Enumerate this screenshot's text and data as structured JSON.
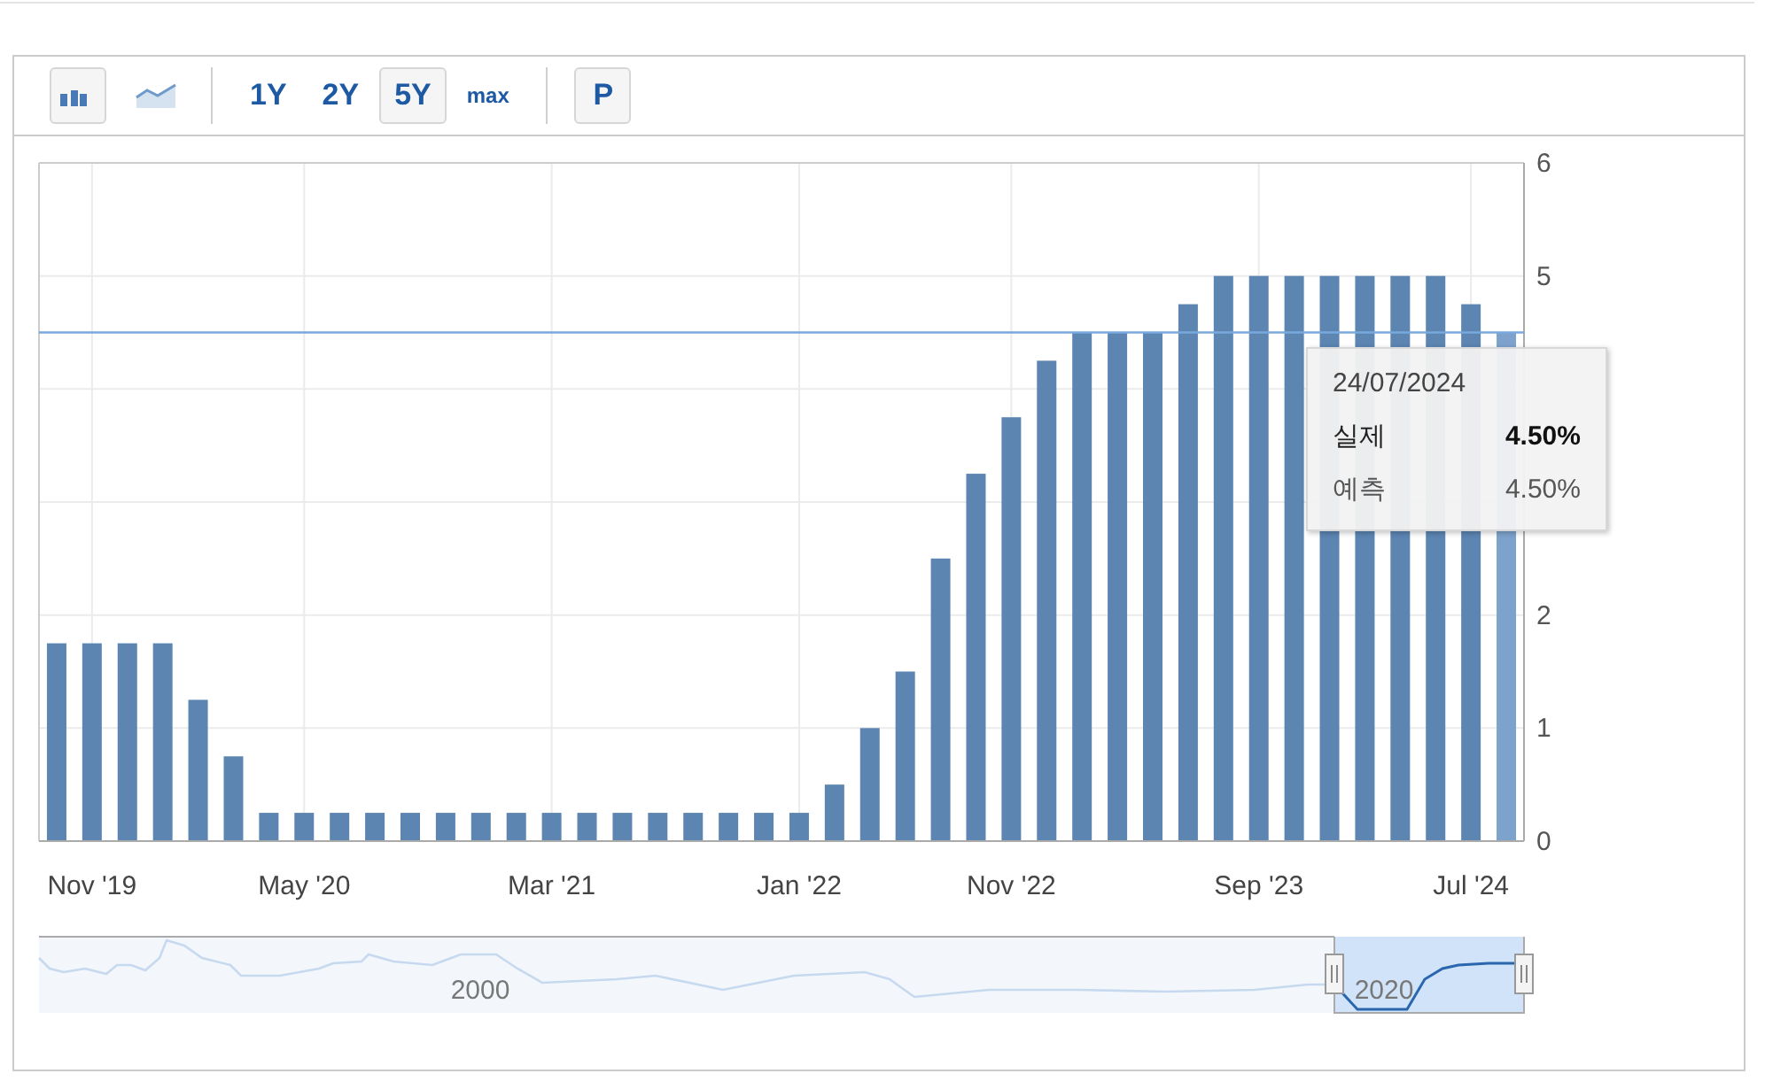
{
  "toolbar": {
    "chart_types": [
      {
        "kind": "bar",
        "selected": true
      },
      {
        "kind": "area",
        "selected": false
      }
    ],
    "ranges": [
      {
        "label": "1Y",
        "selected": false
      },
      {
        "label": "2Y",
        "selected": false
      },
      {
        "label": "5Y",
        "selected": true
      },
      {
        "label": "max",
        "selected": false
      }
    ],
    "extra_button": {
      "label": "P"
    }
  },
  "chart": {
    "chart_data": {
      "type": "bar",
      "values": [
        1.75,
        1.75,
        1.75,
        1.75,
        1.25,
        0.75,
        0.25,
        0.25,
        0.25,
        0.25,
        0.25,
        0.25,
        0.25,
        0.25,
        0.25,
        0.25,
        0.25,
        0.25,
        0.25,
        0.25,
        0.25,
        0.25,
        0.5,
        1.0,
        1.5,
        2.5,
        3.25,
        3.75,
        4.25,
        4.5,
        4.5,
        4.5,
        4.75,
        5.0,
        5.0,
        5.0,
        5.0,
        5.0,
        5.0,
        5.0,
        4.75,
        4.5
      ],
      "categories": [
        null,
        "Nov '19",
        null,
        null,
        null,
        null,
        null,
        "May '20",
        null,
        null,
        null,
        null,
        null,
        null,
        "Mar '21",
        null,
        null,
        null,
        null,
        null,
        null,
        "Jan '22",
        null,
        null,
        null,
        null,
        null,
        "Nov '22",
        null,
        null,
        null,
        null,
        null,
        null,
        "Sep '23",
        null,
        null,
        null,
        null,
        null,
        "Jul '24",
        null
      ],
      "ylim": [
        0,
        6
      ],
      "grid": true,
      "yticks": [
        0,
        1,
        2,
        5,
        6
      ],
      "ref_lines": [
        {
          "axis": "y",
          "value": 4.5
        }
      ]
    },
    "tooltip": {
      "date": "24/07/2024",
      "rows": [
        {
          "label": "실제",
          "value": "4.50%",
          "bold": true
        },
        {
          "label": "예측",
          "value": "4.50%",
          "bold": false
        }
      ]
    }
  },
  "navigator": {
    "labels": [
      "2000",
      "2020"
    ]
  }
}
